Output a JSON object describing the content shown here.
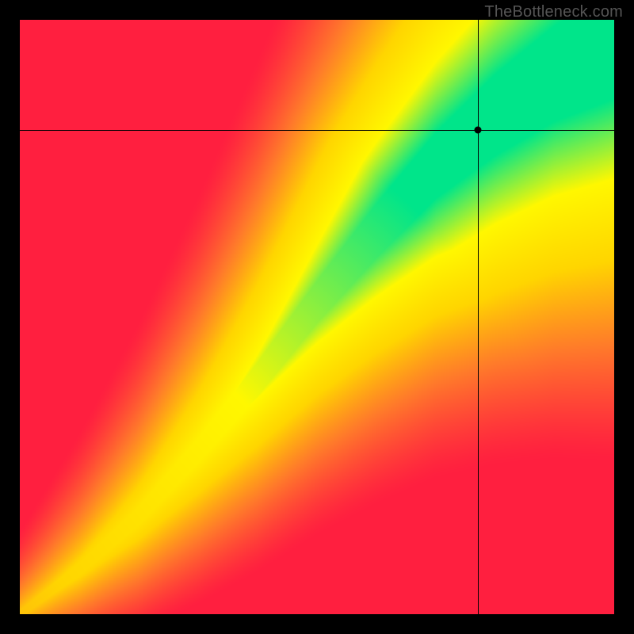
{
  "watermark": "TheBottleneck.com",
  "chart_data": {
    "type": "heatmap",
    "title": "",
    "xlabel": "",
    "ylabel": "",
    "xlim": [
      0,
      1
    ],
    "ylim": [
      0,
      1
    ],
    "legend": null,
    "color_scale": [
      "#ff1f3f",
      "#ff7a2a",
      "#ffd500",
      "#fff700",
      "#00e58a"
    ],
    "description": "Diagonal green optimal band widening toward top-right over red-orange-yellow gradient; black crosshair marks a point inside the green band.",
    "crosshair": {
      "x": 0.77,
      "y": 0.815
    },
    "ridge_samples": [
      {
        "x": 0.0,
        "center": 0.0,
        "halfwidth": 0.006
      },
      {
        "x": 0.1,
        "center": 0.075,
        "halfwidth": 0.01
      },
      {
        "x": 0.2,
        "center": 0.165,
        "halfwidth": 0.015
      },
      {
        "x": 0.3,
        "center": 0.275,
        "halfwidth": 0.02
      },
      {
        "x": 0.4,
        "center": 0.395,
        "halfwidth": 0.028
      },
      {
        "x": 0.5,
        "center": 0.525,
        "halfwidth": 0.035
      },
      {
        "x": 0.6,
        "center": 0.645,
        "halfwidth": 0.045
      },
      {
        "x": 0.7,
        "center": 0.755,
        "halfwidth": 0.055
      },
      {
        "x": 0.8,
        "center": 0.84,
        "halfwidth": 0.068
      },
      {
        "x": 0.9,
        "center": 0.91,
        "halfwidth": 0.08
      },
      {
        "x": 1.0,
        "center": 0.96,
        "halfwidth": 0.092
      }
    ]
  }
}
